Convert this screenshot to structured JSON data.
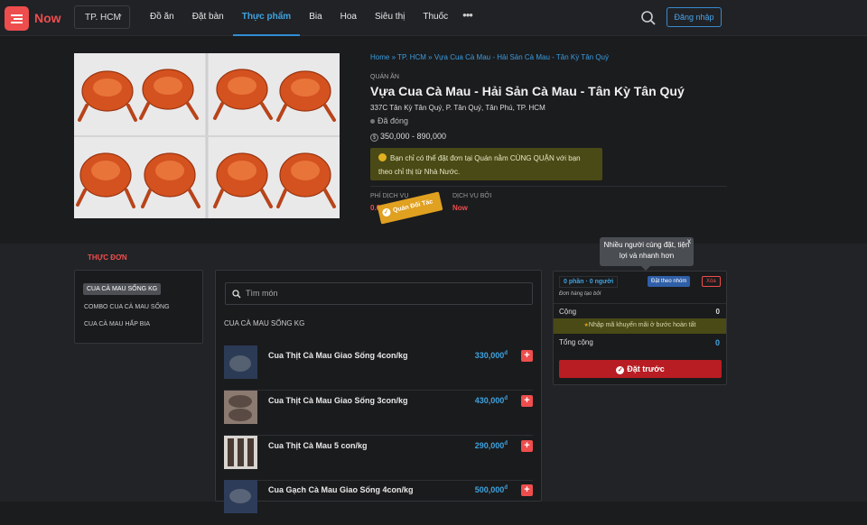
{
  "header": {
    "brand": "Now",
    "city": "TP. HCM",
    "nav": [
      "Đồ ăn",
      "Đặt bàn",
      "Thực phẩm",
      "Bia",
      "Hoa",
      "Siêu thị",
      "Thuốc"
    ],
    "active_nav": "Thực phẩm",
    "more": "•••",
    "login": "Đăng nhập"
  },
  "store": {
    "breadcrumb": "Home » TP. HCM » Vựa Cua Cà Mau - Hải Sản Cà Mau - Tân Kỳ Tân Quý",
    "kind": "QUÁN ĂN",
    "name": "Vựa Cua Cà Mau - Hải Sản Cà Mau - Tân Kỳ Tân Quý",
    "address": "337C Tân Kỳ Tân Quý, P. Tân Quý, Tân Phú, TP. HCM",
    "status": "Đã đóng",
    "price_range": "350,000 - 890,000",
    "notice": "Bạn chỉ có thể đặt đơn tại Quán nằm CÙNG QUẬN với bạn theo chỉ thị từ Nhà Nước.",
    "fee_label": "PHÍ DỊCH VỤ",
    "fee_value": "0.0",
    "partner_badge": "Quán Đối Tác",
    "service_label": "DỊCH VỤ BỞI",
    "service_value": "Now"
  },
  "menu": {
    "heading": "THỰC ĐƠN",
    "categories": [
      "CUA CÀ MAU SỐNG KG",
      "COMBO CUA CÀ MAU SỐNG",
      "CUA CÀ MAU HẤP BIA"
    ],
    "search_placeholder": "Tìm món",
    "section_title": "CUA CÀ MAU SỐNG KG",
    "items": [
      {
        "name": "Cua Thịt Cà Mau Giao Sống 4con/kg",
        "price": "330,000",
        "currency": "đ"
      },
      {
        "name": "Cua Thịt Cà Mau Giao Sống 3con/kg",
        "price": "430,000",
        "currency": "đ"
      },
      {
        "name": "Cua Thịt Cà Mau 5 con/kg",
        "price": "290,000",
        "currency": "đ"
      },
      {
        "name": "Cua Gạch Cà Mau Giao Sống 4con/kg",
        "price": "500,000",
        "currency": "đ"
      }
    ]
  },
  "cart": {
    "tooltip": "Nhiều người cùng đặt, tiện lợi và nhanh hơn",
    "tooltip_close": "x",
    "people": "0 phần · 0 người",
    "group_button": "Đặt theo nhóm",
    "delete_button": "Xóa",
    "created_by": "Đơn hàng tạo bởi",
    "subtotal_label": "Cộng",
    "subtotal_value": "0",
    "promo": "Nhập mã khuyến mãi ở bước hoàn tất",
    "total_label": "Tổng cộng",
    "total_value": "0",
    "order_button": "Đặt trước"
  },
  "colors": {
    "brand": "#ee4d4d",
    "link": "#3fa3e0",
    "notice_bg": "#4a4a16",
    "order": "#b81d23"
  }
}
